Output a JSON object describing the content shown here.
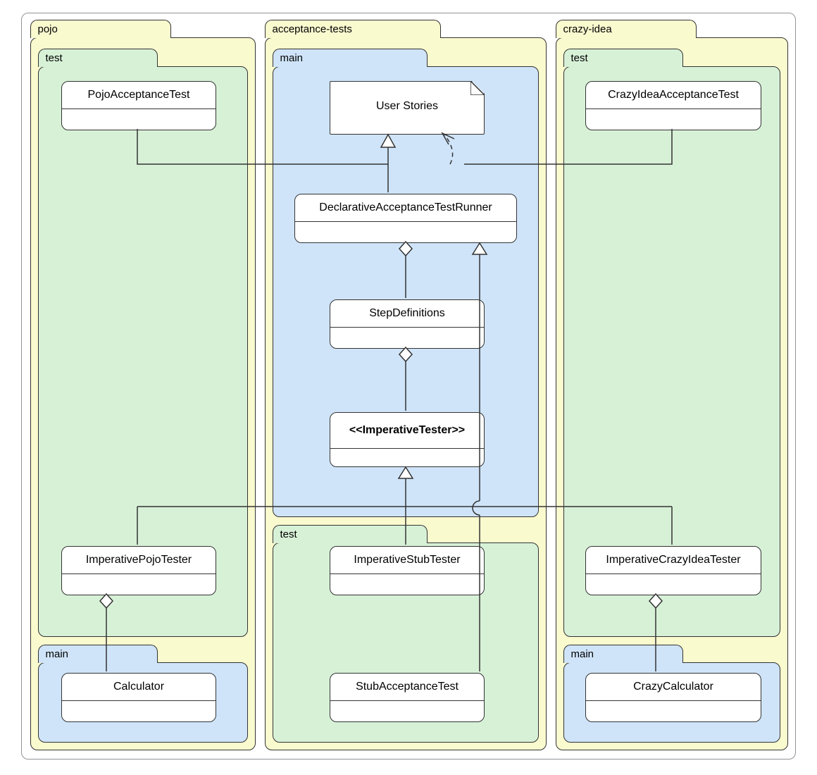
{
  "packages": {
    "pojo": {
      "label": "pojo",
      "test": "test",
      "main": "main"
    },
    "acceptance": {
      "label": "acceptance-tests",
      "main": "main",
      "test": "test"
    },
    "crazy": {
      "label": "crazy-idea",
      "test": "test",
      "main": "main"
    }
  },
  "classes": {
    "pojoAcceptanceTest": "PojoAcceptanceTest",
    "crazyIdeaAcceptanceTest": "CrazyIdeaAcceptanceTest",
    "userStories": "User Stories",
    "declarativeRunner": "DeclarativeAcceptanceTestRunner",
    "stepDefinitions": "StepDefinitions",
    "imperativeTester": "<<ImperativeTester>>",
    "imperativePojoTester": "ImperativePojoTester",
    "imperativeStubTester": "ImperativeStubTester",
    "imperativeCrazyIdeaTester": "ImperativeCrazyIdeaTester",
    "calculator": "Calculator",
    "stubAcceptanceTest": "StubAcceptanceTest",
    "crazyCalculator": "CrazyCalculator"
  }
}
